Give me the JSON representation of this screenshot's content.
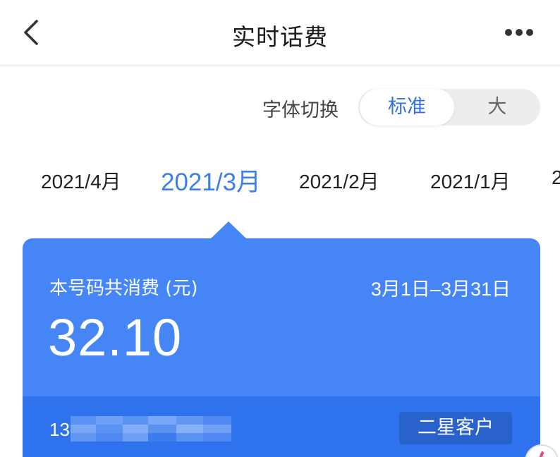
{
  "header": {
    "title": "实时话费",
    "back_icon": "chevron-left-icon",
    "more_icon": "more-horizontal-icon"
  },
  "font_switch": {
    "label": "字体切换",
    "options": [
      "标准",
      "大"
    ],
    "selected": "标准"
  },
  "months": {
    "items": [
      "2021/4月",
      "2021/3月",
      "2021/2月",
      "2021/1月",
      "2"
    ],
    "selected": "2021/3月"
  },
  "summary_card": {
    "label": "本号码共消费 (元)",
    "date_range": "3月1日–3月31日",
    "amount": "32.10",
    "phone_prefix": "13",
    "customer_level": "二星客户"
  },
  "colors": {
    "accent": "#3a7ff0",
    "card": "#4585f5",
    "card_footer": "#2f72ee",
    "badge": "#2a62cc"
  }
}
